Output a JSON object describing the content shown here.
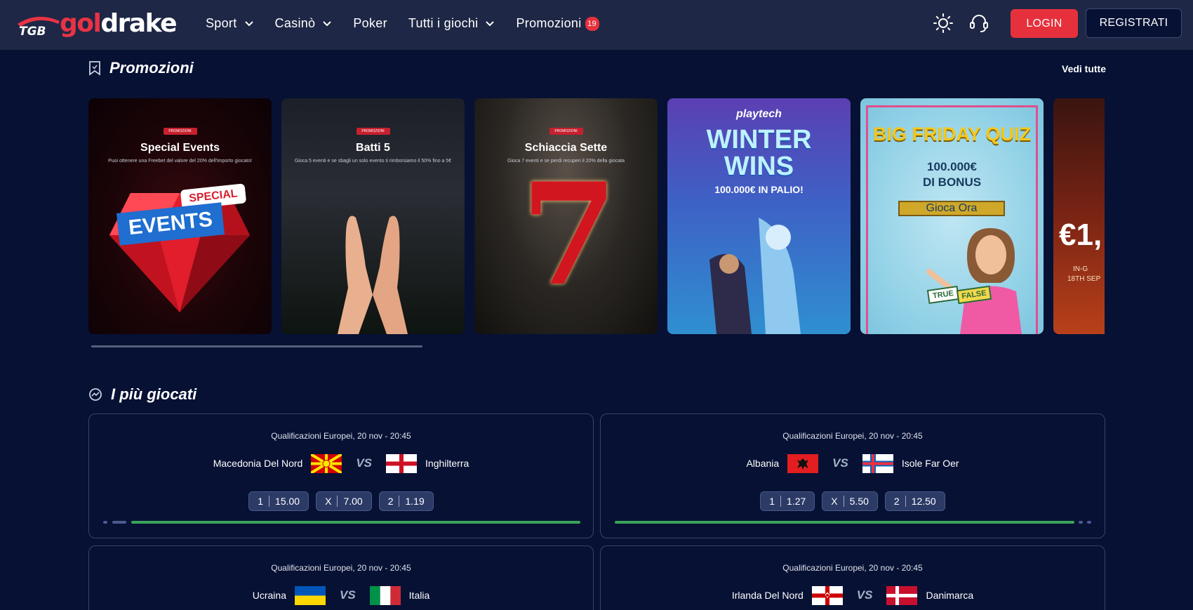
{
  "header": {
    "logo": {
      "part1": "gol",
      "part2": "drake",
      "mark_text": "TGB"
    },
    "nav": [
      {
        "label": "Sport",
        "has_dropdown": true
      },
      {
        "label": "Casinò",
        "has_dropdown": true
      },
      {
        "label": "Poker",
        "has_dropdown": false
      },
      {
        "label": "Tutti i giochi",
        "has_dropdown": true
      },
      {
        "label": "Promozioni",
        "has_dropdown": false,
        "badge": "19"
      }
    ],
    "icons": [
      "theme-sun-icon",
      "support-headset-icon"
    ],
    "login_label": "LOGIN",
    "register_label": "REGISTRATI"
  },
  "promotions": {
    "title": "Promozioni",
    "see_all": "Vedi tutte",
    "cards": [
      {
        "tag": "PROMOZIONI",
        "title": "Special Events",
        "subtitle": "Puoi ottenere una Freebet del valore del 20% dell'importo giocato!",
        "art_text_1": "SPECIAL",
        "art_text_2": "EVENTS"
      },
      {
        "tag": "PROMOZIONI",
        "title": "Batti 5",
        "subtitle": "Gioca 5 eventi e se sbagli un solo evento ti rimborsiamo il 50% fino a 5€"
      },
      {
        "tag": "PROMOZIONI",
        "title": "Schiaccia Sette",
        "subtitle": "Gioca 7 eventi e se perdi recuperi il 20% della giocata",
        "art_text": "7"
      },
      {
        "brand": "playtech",
        "title_line1": "WINTER",
        "title_line2": "WINS",
        "subtitle": "100.000€ IN PALIO!"
      },
      {
        "title": "BIG FRIDAY QUIZ",
        "line1": "100.000€",
        "line2": "DI BONUS",
        "cta": "Gioca Ora",
        "badge_1": "TRUE",
        "badge_2": "FALSE"
      },
      {
        "title": "€1,",
        "line1": "IN-G",
        "line2": "18TH SEP"
      }
    ],
    "accent": "#c8202e"
  },
  "most_played": {
    "title": "I più giocati",
    "vs_label": "VS",
    "matches": [
      {
        "event": "Qualificazioni Europei, 20 nov - 20:45",
        "home": "Macedonia Del Nord",
        "away": "Inghilterra",
        "home_flag": "north-macedonia-flag",
        "away_flag": "england-flag",
        "odds": [
          {
            "label": "1",
            "value": "15.00"
          },
          {
            "label": "X",
            "value": "7.00"
          },
          {
            "label": "2",
            "value": "1.19"
          }
        ]
      },
      {
        "event": "Qualificazioni Europei, 20 nov - 20:45",
        "home": "Albania",
        "away": "Isole Far Oer",
        "home_flag": "albania-flag",
        "away_flag": "faroe-islands-flag",
        "odds": [
          {
            "label": "1",
            "value": "1.27"
          },
          {
            "label": "X",
            "value": "5.50"
          },
          {
            "label": "2",
            "value": "12.50"
          }
        ]
      },
      {
        "event": "Qualificazioni Europei, 20 nov - 20:45",
        "home": "Ucraina",
        "away": "Italia",
        "home_flag": "ukraine-flag",
        "away_flag": "italy-flag"
      },
      {
        "event": "Qualificazioni Europei, 20 nov - 20:45",
        "home": "Irlanda Del Nord",
        "away": "Danimarca",
        "home_flag": "northern-ireland-flag",
        "away_flag": "denmark-flag"
      }
    ],
    "progress_color": "#3aa45a"
  }
}
